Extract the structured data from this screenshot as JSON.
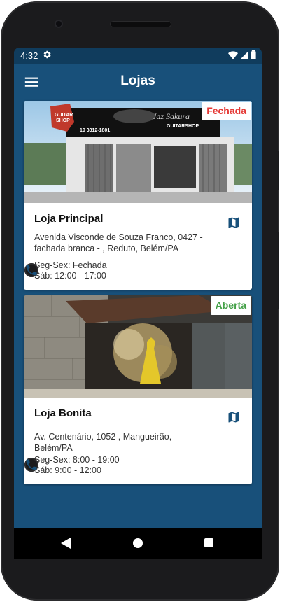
{
  "status_bar": {
    "time": "4:32"
  },
  "app_bar": {
    "title": "Lojas"
  },
  "colors": {
    "primary": "#18507a",
    "status_dark": "#103c5d",
    "closed": "#e53935",
    "open": "#43a047"
  },
  "stores": [
    {
      "name": "Loja Principal",
      "status": "Fechada",
      "address_line1": "Avenida Visconde de Souza Franco, 0427 -",
      "address_line2": "fachada branca - , Reduto, Belém/PA",
      "hours_week": "Seg-Sex: Fechada",
      "hours_sat": "Sáb: 12:00 - 17:00",
      "sign_phone": "19 3312-1801",
      "sign_name": "Jaz Sakura",
      "sign_shop": "GUITARSHOP",
      "sign_guitar_line1": "GUITAR",
      "sign_guitar_line2": "SHOP"
    },
    {
      "name": "Loja Bonita",
      "status": "Aberta",
      "address_line1": "Av. Centenário, 1052 , Mangueirão, Belém/PA",
      "hours_week": "Seg-Sex: 8:00 - 19:00",
      "hours_sat": "Sáb: 9:00 - 12:00"
    }
  ],
  "icons": {
    "menu": "hamburger-menu-icon",
    "map": "map-icon",
    "phone": "phone-icon",
    "settings": "gear-icon"
  }
}
